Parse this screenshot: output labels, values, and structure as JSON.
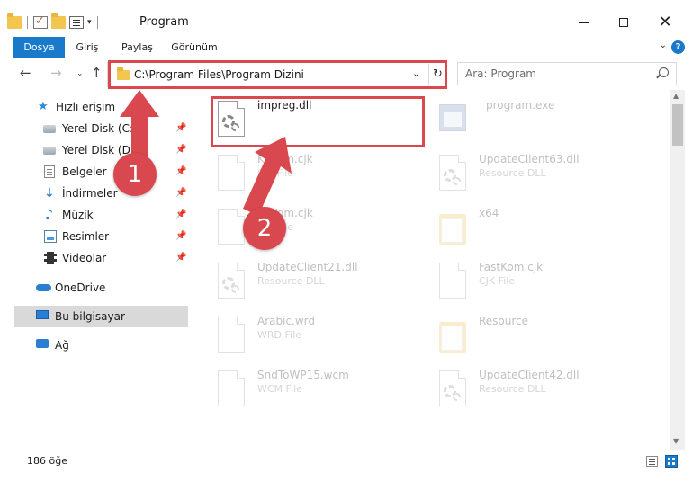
{
  "window": {
    "title": "Program"
  },
  "ribbon": {
    "tabs": [
      "Dosya",
      "Giriş",
      "Paylaş",
      "Görünüm"
    ]
  },
  "address": {
    "path": "C:\\Program Files\\Program Dizini"
  },
  "search": {
    "placeholder": "Ara: Program"
  },
  "sidebar": {
    "quick_access": "Hızlı erişim",
    "items": [
      {
        "label": "Yerel Disk (C:)",
        "icon": "disk-c-icon",
        "pinned": true
      },
      {
        "label": "Yerel Disk (D:)",
        "icon": "disk-d-icon",
        "pinned": true
      },
      {
        "label": "Belgeler",
        "icon": "documents-icon",
        "pinned": true
      },
      {
        "label": "İndirmeler",
        "icon": "downloads-icon",
        "pinned": true
      },
      {
        "label": "Müzik",
        "icon": "music-icon",
        "pinned": true
      },
      {
        "label": "Resimler",
        "icon": "pictures-icon",
        "pinned": true
      },
      {
        "label": "Videolar",
        "icon": "videos-icon",
        "pinned": true
      }
    ],
    "onedrive": "OneDrive",
    "this_pc": "Bu bilgisayar",
    "network": "Ağ"
  },
  "files": [
    {
      "name": "impreg.dll",
      "type": "",
      "icon": "dll-icon",
      "highlighted": true
    },
    {
      "name": "program.exe",
      "type": "",
      "icon": "exe-icon"
    },
    {
      "name": "KoKom.cjk",
      "type": "CJK File",
      "icon": "file-icon"
    },
    {
      "name": "UpdateClient63.dll",
      "type": "Resource DLL",
      "icon": "dll-icon"
    },
    {
      "name": "FKKom.cjk",
      "type": "CJK File",
      "icon": "file-icon"
    },
    {
      "name": "x64",
      "type": "",
      "icon": "folder-icon"
    },
    {
      "name": "UpdateClient21.dll",
      "type": "Resource DLL",
      "icon": "dll-icon"
    },
    {
      "name": "FastKom.cjk",
      "type": "CJK File",
      "icon": "file-icon"
    },
    {
      "name": "Arabic.wrd",
      "type": "WRD File",
      "icon": "file-icon"
    },
    {
      "name": "Resource",
      "type": "",
      "icon": "folder-icon"
    },
    {
      "name": "SndToWP15.wcm",
      "type": "WCM File",
      "icon": "file-icon"
    },
    {
      "name": "UpdateClient42.dll",
      "type": "Resource DLL",
      "icon": "dll-icon"
    }
  ],
  "status": {
    "count": "186 öğe"
  },
  "annotations": {
    "step1": "1",
    "step2": "2",
    "color": "#d9484e"
  },
  "colors": {
    "accent": "#1979ca",
    "highlight": "#d9484e"
  }
}
